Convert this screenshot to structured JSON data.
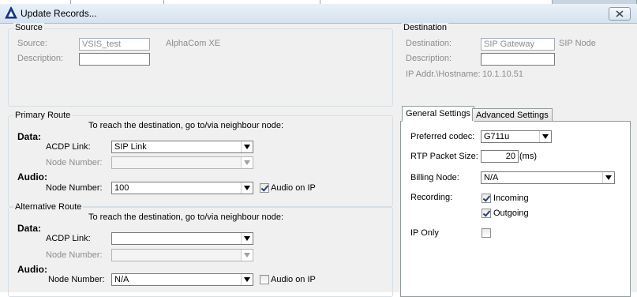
{
  "window": {
    "title": "Update Records..."
  },
  "source": {
    "group_label": "Source",
    "source_label": "Source:",
    "source_value": "VSIS_test",
    "source_type": "AlphaCom XE",
    "description_label": "Description:",
    "description_value": ""
  },
  "destination": {
    "group_label": "Destination",
    "destination_label": "Destination:",
    "destination_value": "SIP Gateway",
    "destination_type": "SIP Node",
    "description_label": "Description:",
    "description_value": "",
    "ip_label": "IP Addr.\\Hostname:",
    "ip_value": "10.1.10.51"
  },
  "primary_route": {
    "group_label": "Primary Route",
    "instruction": "To reach the destination, go to/via neighbour node:",
    "data_label": "Data:",
    "acdp_link_label": "ACDP Link:",
    "acdp_link_value": "SIP Link",
    "node_number_label": "Node Number:",
    "node_number_value": "",
    "audio_label": "Audio:",
    "audio_node_label": "Node Number:",
    "audio_node_value": "100",
    "audio_on_ip_label": "Audio on IP",
    "audio_on_ip_checked": true
  },
  "alternative_route": {
    "group_label": "Alternative Route",
    "instruction": "To reach the destination, go to/via neighbour node:",
    "data_label": "Data:",
    "acdp_link_label": "ACDP Link:",
    "acdp_link_value": "",
    "node_number_label": "Node Number:",
    "node_number_value": "",
    "audio_label": "Audio:",
    "audio_node_label": "Node Number:",
    "audio_node_value": "N/A",
    "audio_on_ip_label": "Audio on IP",
    "audio_on_ip_checked": false
  },
  "settings": {
    "tabs": [
      {
        "label": "General Settings",
        "active": true
      },
      {
        "label": "Advanced Settings",
        "active": false
      }
    ],
    "preferred_codec_label": "Preferred codec:",
    "preferred_codec_value": "G711u",
    "rtp_packet_size_label": "RTP Packet Size:",
    "rtp_packet_size_value": "20",
    "rtp_packet_size_unit": "(ms)",
    "billing_node_label": "Billing Node:",
    "billing_node_value": "N/A",
    "recording_label": "Recording:",
    "incoming_label": "Incoming",
    "incoming_checked": true,
    "outgoing_label": "Outgoing",
    "outgoing_checked": true,
    "ip_only_label": "IP Only",
    "ip_only_checked": false
  }
}
